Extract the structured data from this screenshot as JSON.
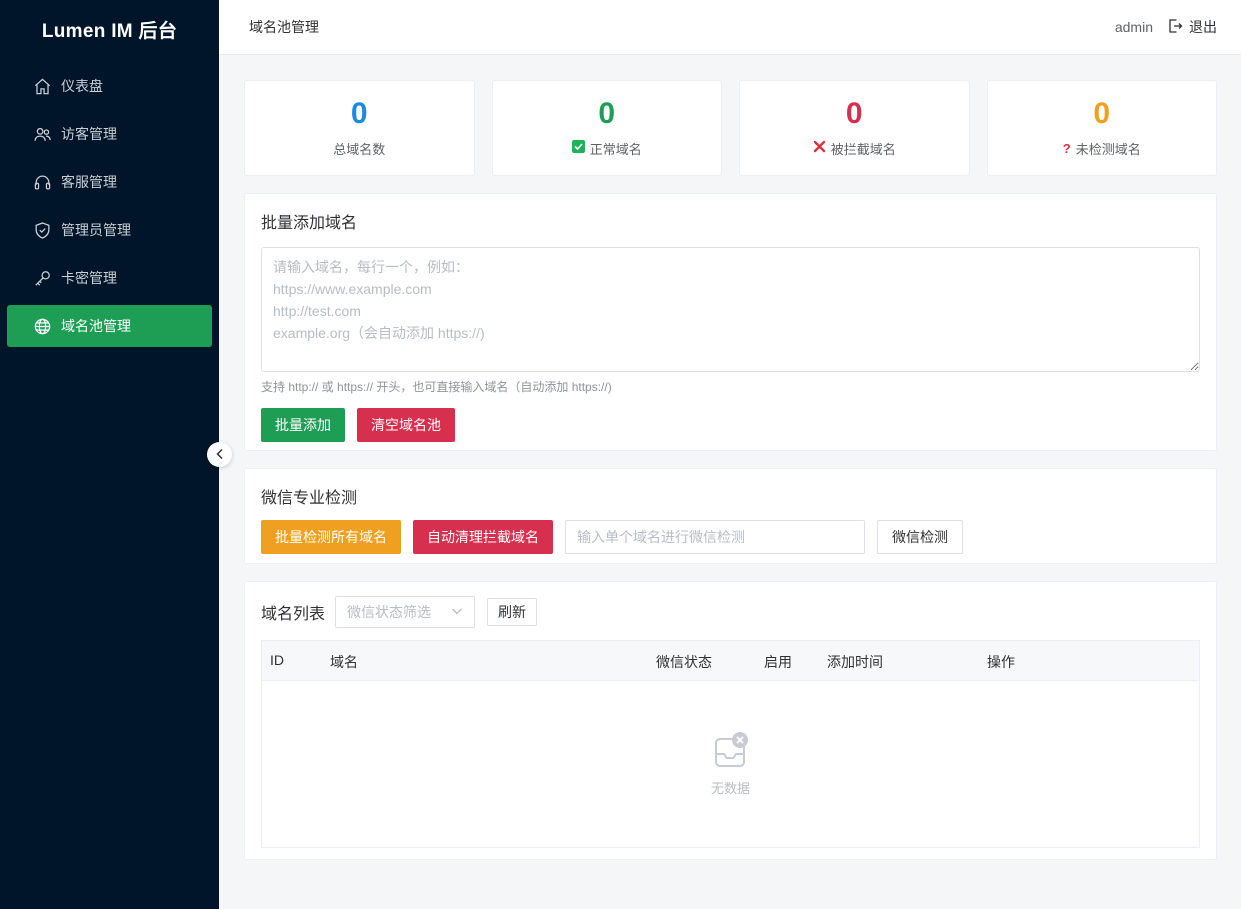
{
  "app": {
    "title": "Lumen IM 后台"
  },
  "sidebar": {
    "items": [
      {
        "label": "仪表盘",
        "icon": "home-icon"
      },
      {
        "label": "访客管理",
        "icon": "users-icon"
      },
      {
        "label": "客服管理",
        "icon": "headset-icon"
      },
      {
        "label": "管理员管理",
        "icon": "shield-icon"
      },
      {
        "label": "卡密管理",
        "icon": "key-icon"
      },
      {
        "label": "域名池管理",
        "icon": "globe-icon",
        "active": true
      }
    ]
  },
  "header": {
    "title": "域名池管理",
    "user": "admin",
    "logout_label": "退出"
  },
  "stats": [
    {
      "value": "0",
      "label": "总域名数",
      "color": "#1e88e5"
    },
    {
      "value": "0",
      "label": "正常域名",
      "color": "#1e9e54",
      "icon": "check-box-icon"
    },
    {
      "value": "0",
      "label": "被拦截域名",
      "color": "#d6304e",
      "icon": "cross-icon"
    },
    {
      "value": "0",
      "label": "未检测域名",
      "color": "#f0a020",
      "icon": "question-icon"
    }
  ],
  "bulk_add": {
    "title": "批量添加域名",
    "placeholder": "请输入域名，每行一个，例如：\nhttps://www.example.com\nhttp://test.com\nexample.org（会自动添加 https://)",
    "hint": "支持 http:// 或 https:// 开头，也可直接输入域名（自动添加 https://)",
    "add_label": "批量添加",
    "clear_label": "清空域名池"
  },
  "wechat_check": {
    "title": "微信专业检测",
    "batch_label": "批量检测所有域名",
    "auto_clean_label": "自动清理拦截域名",
    "input_placeholder": "输入单个域名进行微信检测",
    "check_label": "微信检测"
  },
  "domain_list": {
    "title": "域名列表",
    "filter_placeholder": "微信状态筛选",
    "refresh_label": "刷新",
    "columns": [
      "ID",
      "域名",
      "微信状态",
      "启用",
      "添加时间",
      "操作"
    ],
    "rows": [],
    "empty_text": "无数据"
  },
  "colors": {
    "sidebar_bg": "#001529",
    "accent_green": "#1e9e54",
    "danger": "#d6304e",
    "warning": "#f0a020",
    "primary": "#1e88e5"
  }
}
